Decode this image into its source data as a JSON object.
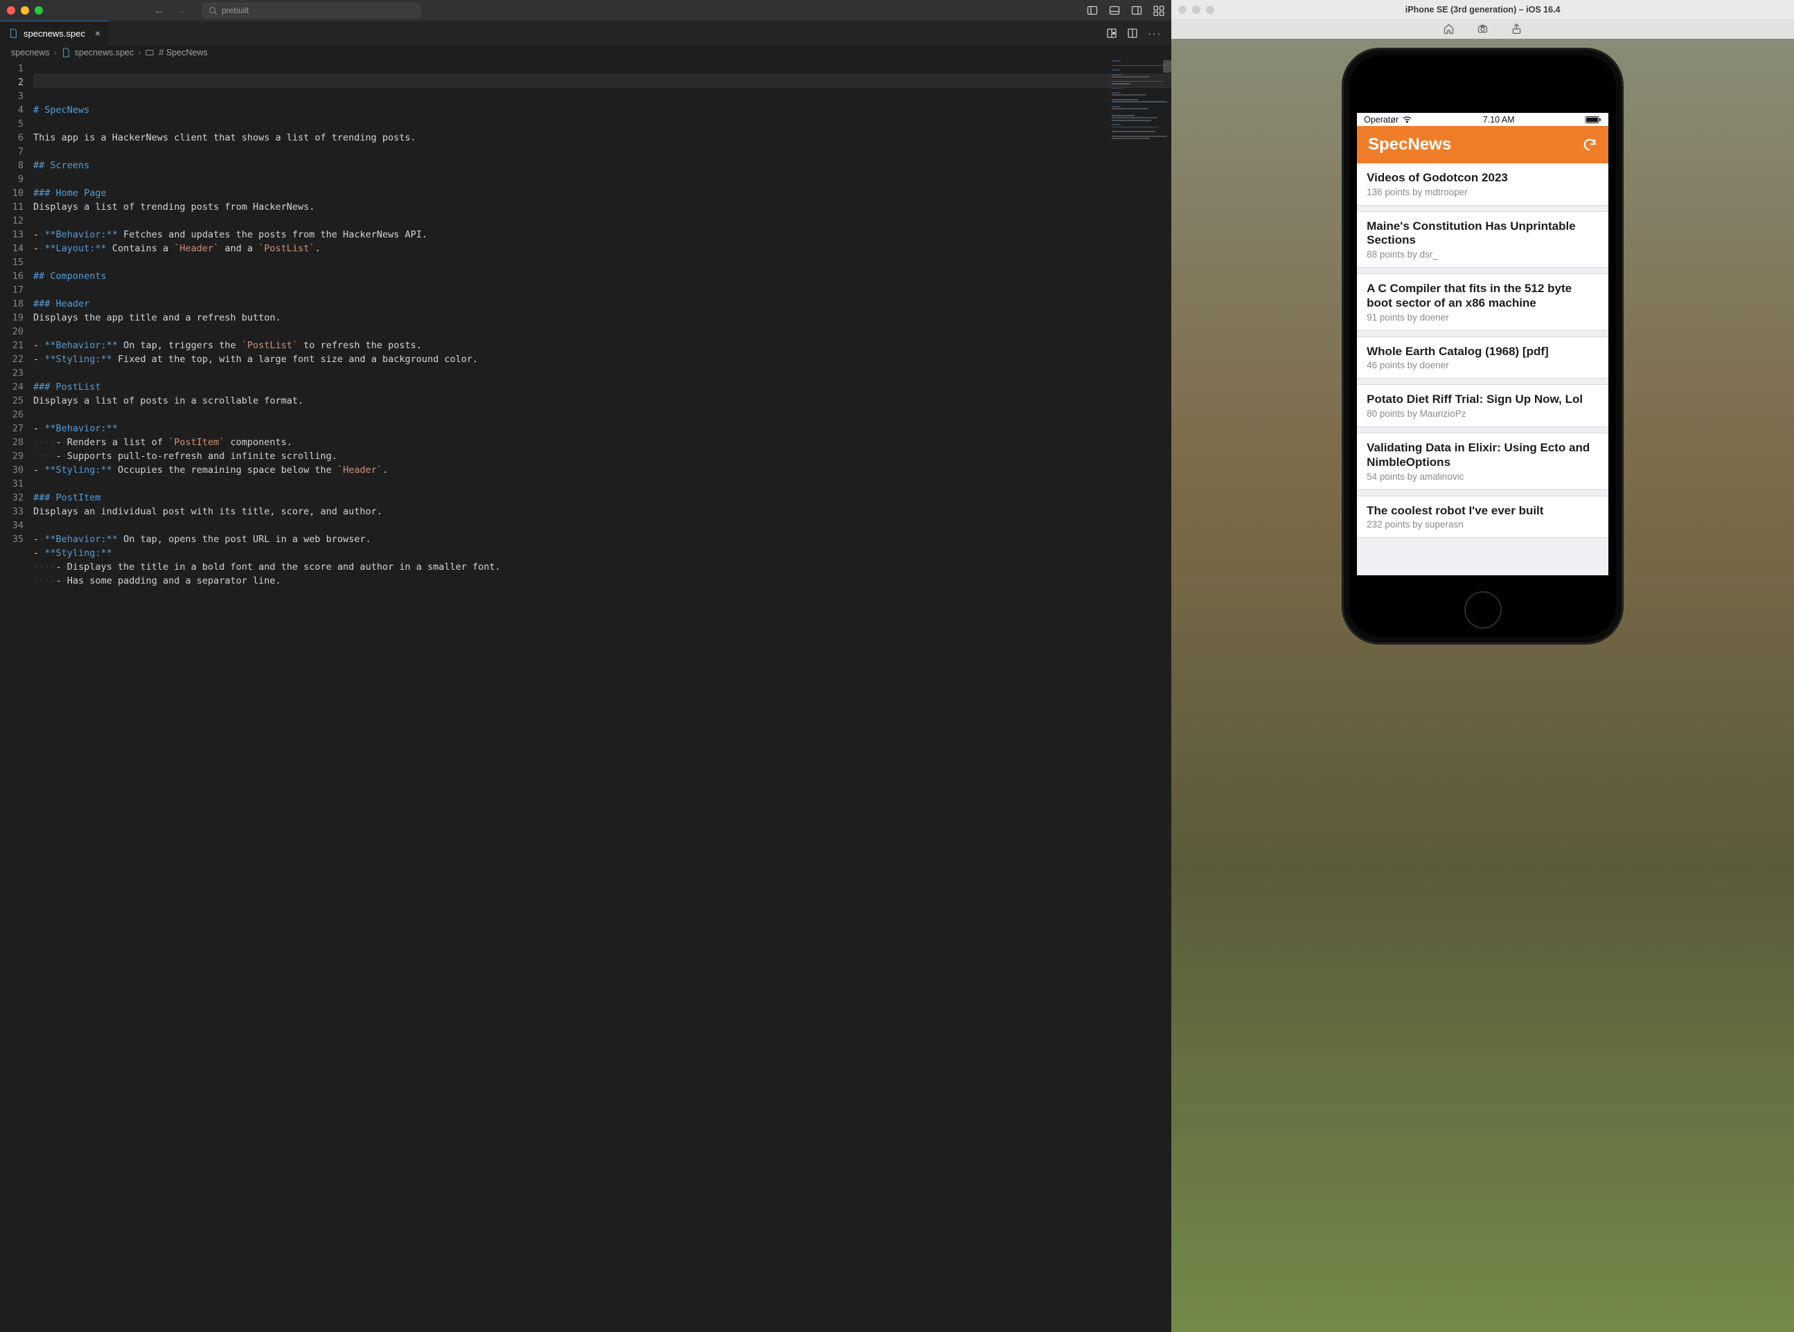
{
  "vscode": {
    "search_placeholder": "prebuilt",
    "tab": {
      "filename": "specnews.spec"
    },
    "breadcrumb": {
      "seg1": "specnews",
      "seg2": "specnews.spec",
      "seg3": "SpecNews"
    },
    "editor": {
      "lines": [
        {
          "n": 1,
          "h": "#",
          "ws": "·",
          "t": "SpecNews"
        },
        {
          "n": 2,
          "cur": true,
          "raw": ""
        },
        {
          "n": 3,
          "raw": "This app is a HackerNews client that shows a list of trending posts."
        },
        {
          "n": 4,
          "raw": ""
        },
        {
          "n": 5,
          "h": "##",
          "ws": "·",
          "t": "Screens"
        },
        {
          "n": 6,
          "raw": ""
        },
        {
          "n": 7,
          "h": "###",
          "ws": "·",
          "t": "Home Page"
        },
        {
          "n": 8,
          "raw": "Displays a list of trending posts from HackerNews."
        },
        {
          "n": 9,
          "raw": ""
        },
        {
          "n": 10,
          "bullet": "-",
          "ws": "·",
          "bold": "**Behavior:**",
          "rest": " Fetches and updates the posts from the HackerNews API."
        },
        {
          "n": 11,
          "bullet": "-",
          "ws": "·",
          "bold": "**Layout:**",
          "rest": " Contains a ",
          "code": "`Header`",
          "rest2": " and a ",
          "code2": "`PostList`",
          "rest3": "."
        },
        {
          "n": 12,
          "raw": ""
        },
        {
          "n": 13,
          "h": "##",
          "ws": "·",
          "t": "Components"
        },
        {
          "n": 14,
          "raw": ""
        },
        {
          "n": 15,
          "h": "###",
          "ws": "·",
          "t": "Header"
        },
        {
          "n": 16,
          "raw": "Displays the app title and a refresh button."
        },
        {
          "n": 17,
          "raw": ""
        },
        {
          "n": 18,
          "bullet": "-",
          "ws": "·",
          "bold": "**Behavior:**",
          "rest": " On tap, triggers the ",
          "code": "`PostList`",
          "rest2": " to refresh the posts."
        },
        {
          "n": 19,
          "bullet": "-",
          "ws": "·",
          "bold": "**Styling:**",
          "rest": " Fixed at the top, with a large font size and a background color."
        },
        {
          "n": 20,
          "raw": ""
        },
        {
          "n": 21,
          "h": "###",
          "ws": "·",
          "t": "PostList"
        },
        {
          "n": 22,
          "raw": "Displays a list of posts in a scrollable format."
        },
        {
          "n": 23,
          "raw": ""
        },
        {
          "n": 24,
          "bullet": "-",
          "ws": "·",
          "bold": "**Behavior:**"
        },
        {
          "n": 25,
          "indent": "····",
          "bullet": "-",
          "ws": "·",
          "rest": "Renders a list of ",
          "code": "`PostItem`",
          "rest2": " components."
        },
        {
          "n": 26,
          "indent": "····",
          "bullet": "-",
          "ws": "·",
          "rest": "Supports pull-to-refresh and infinite scrolling."
        },
        {
          "n": 27,
          "bullet": "-",
          "ws": "·",
          "bold": "**Styling:**",
          "rest": " Occupies the remaining space below the ",
          "code": "`Header`",
          "rest2": "."
        },
        {
          "n": 28,
          "raw": ""
        },
        {
          "n": 29,
          "h": "###",
          "ws": "·",
          "t": "PostItem"
        },
        {
          "n": 30,
          "raw": "Displays an individual post with its title, score, and author."
        },
        {
          "n": 31,
          "raw": ""
        },
        {
          "n": 32,
          "bullet": "-",
          "ws": "·",
          "bold": "**Behavior:**",
          "rest": " On tap, opens the post URL in a web browser."
        },
        {
          "n": 33,
          "bullet": "-",
          "ws": "·",
          "bold": "**Styling:**"
        },
        {
          "n": 34,
          "indent": "····",
          "bullet": "-",
          "ws": "·",
          "rest": "Displays the title in a bold font and the score and author in a smaller font."
        },
        {
          "n": 35,
          "indent": "····",
          "bullet": "-",
          "ws": "·",
          "rest": "Has some padding and a separator line."
        }
      ]
    }
  },
  "simulator": {
    "window_title": "iPhone SE (3rd generation) – iOS 16.4",
    "statusbar": {
      "carrier": "Operatør",
      "time": "7.10 AM"
    },
    "app": {
      "title": "SpecNews",
      "posts": [
        {
          "title": "Videos of Godotcon 2023",
          "sub": "136 points by mdtrooper"
        },
        {
          "title": "Maine's Constitution Has Unprintable Sections",
          "sub": "88 points by dsr_"
        },
        {
          "title": "A C Compiler that fits in the 512 byte boot sector of an x86 machine",
          "sub": "91 points by doener"
        },
        {
          "title": "Whole Earth Catalog (1968) [pdf]",
          "sub": "46 points by doener"
        },
        {
          "title": "Potato Diet Riff Trial: Sign Up Now, Lol",
          "sub": "80 points by MaurizioPz"
        },
        {
          "title": "Validating Data in Elixir: Using Ecto and NimbleOptions",
          "sub": "54 points by amalinovic"
        },
        {
          "title": "The coolest robot I've ever built",
          "sub": "232 points by superasn"
        }
      ]
    }
  }
}
